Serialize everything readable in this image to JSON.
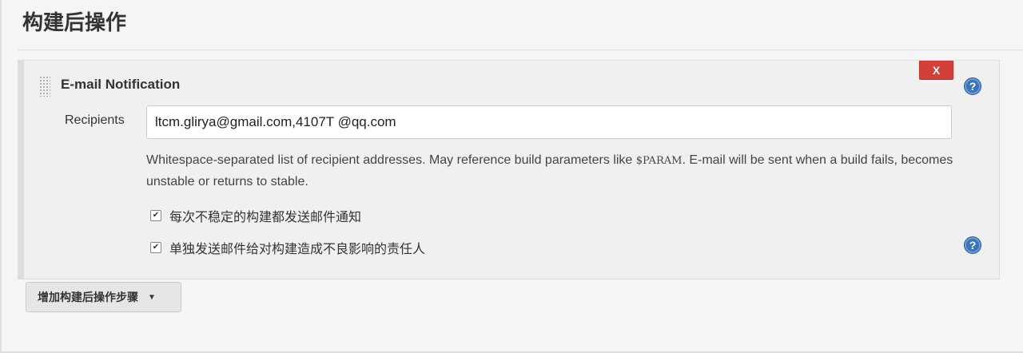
{
  "section": {
    "title": "构建后操作"
  },
  "email_panel": {
    "name": "E-mail Notification",
    "delete_label": "X",
    "help_label": "?",
    "recipients_label": "Recipients",
    "recipients_value": "ltcm.glirya@gmail.com,4107T @qq.com",
    "description_part1": "Whitespace-separated list of recipient addresses. May reference build parameters like ",
    "description_code": "$PARAM",
    "description_part2": ". E-mail will be sent when a build fails, becomes unstable or returns to stable.",
    "checkbox_unstable": {
      "label": "每次不稳定的构建都发送邮件通知",
      "checked": true
    },
    "checkbox_individual": {
      "label": "单独发送邮件给对构建造成不良影响的责任人",
      "checked": true
    }
  },
  "add_step_button": {
    "label": "增加构建后操作步骤"
  },
  "colors": {
    "danger": "#d43f3a",
    "help": "#3b73b9"
  }
}
